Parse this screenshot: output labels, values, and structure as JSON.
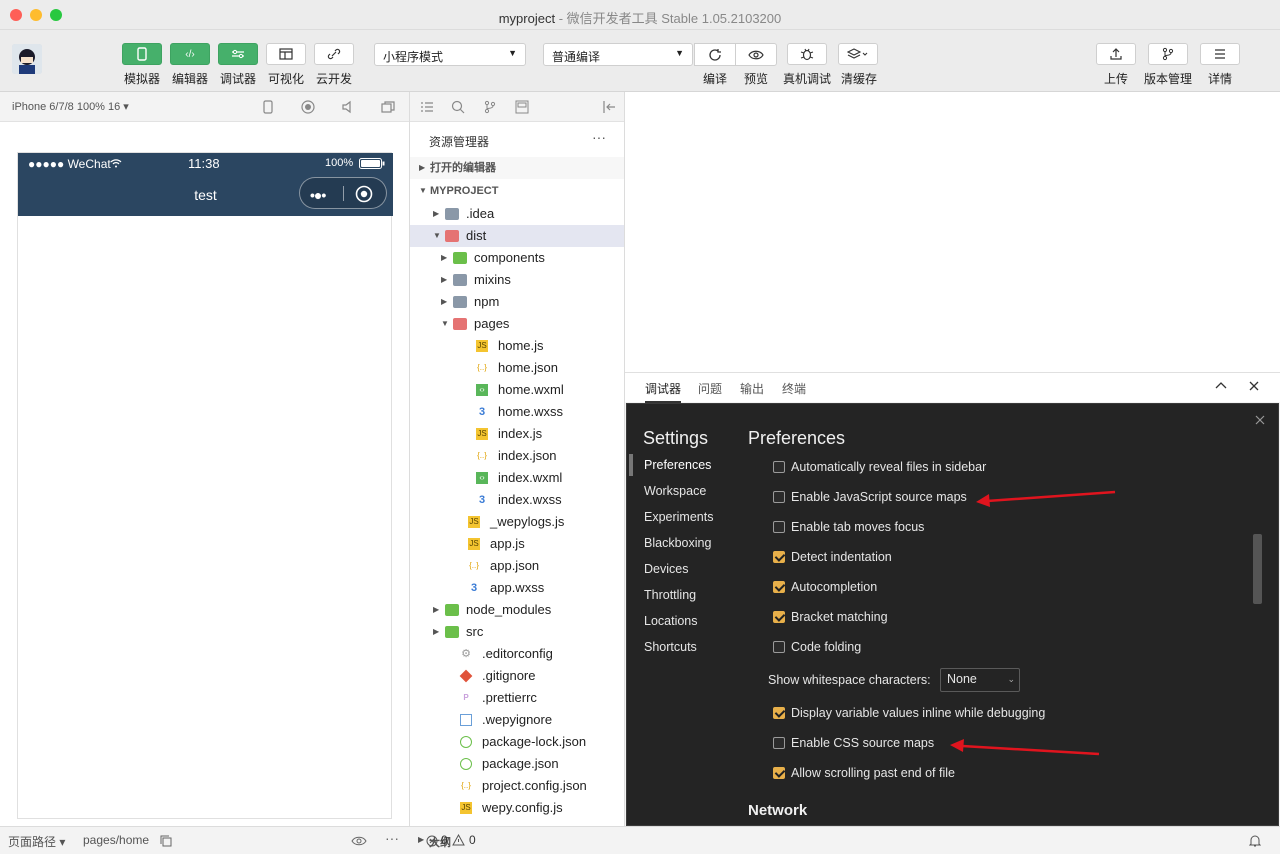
{
  "window": {
    "title": "myproject",
    "subtitle": "-  微信开发者工具 Stable 1.05.2103200"
  },
  "toolbar": {
    "simulator": "模拟器",
    "editor": "编辑器",
    "debugger": "调试器",
    "visual": "可视化",
    "cloud": "云开发",
    "mode_select": "小程序模式",
    "compile_select": "普通编译",
    "compile": "编译",
    "preview": "预览",
    "device_debug": "真机调试",
    "clear_cache": "清缓存",
    "upload": "上传",
    "version": "版本管理",
    "details": "详情"
  },
  "simulator": {
    "device": "iPhone 6/7/8 100% 16 ▾",
    "status_left": "●●●●● WeChat",
    "time": "11:38",
    "battery": "100%",
    "page_title": "test",
    "footer_path_label": "页面路径 ▾",
    "footer_path": "pages/home"
  },
  "explorer": {
    "title": "资源管理器",
    "open_editors": "打开的编辑器",
    "project": "MYPROJECT",
    "outline": "大纲",
    "tree": [
      {
        "name": ".idea",
        "depth": 0,
        "type": "folder",
        "open": false
      },
      {
        "name": "dist",
        "depth": 0,
        "type": "folder-red",
        "open": true,
        "selected": true
      },
      {
        "name": "components",
        "depth": 1,
        "type": "folder-green",
        "open": false
      },
      {
        "name": "mixins",
        "depth": 1,
        "type": "folder",
        "open": false
      },
      {
        "name": "npm",
        "depth": 1,
        "type": "folder",
        "open": false
      },
      {
        "name": "pages",
        "depth": 1,
        "type": "folder-red",
        "open": true
      },
      {
        "name": "home.js",
        "depth": 2,
        "type": "js"
      },
      {
        "name": "home.json",
        "depth": 2,
        "type": "json"
      },
      {
        "name": "home.wxml",
        "depth": 2,
        "type": "wxml"
      },
      {
        "name": "home.wxss",
        "depth": 2,
        "type": "wxss"
      },
      {
        "name": "index.js",
        "depth": 2,
        "type": "js"
      },
      {
        "name": "index.json",
        "depth": 2,
        "type": "json"
      },
      {
        "name": "index.wxml",
        "depth": 2,
        "type": "wxml"
      },
      {
        "name": "index.wxss",
        "depth": 2,
        "type": "wxss"
      },
      {
        "name": "_wepylogs.js",
        "depth": 1,
        "type": "js"
      },
      {
        "name": "app.js",
        "depth": 1,
        "type": "js"
      },
      {
        "name": "app.json",
        "depth": 1,
        "type": "json"
      },
      {
        "name": "app.wxss",
        "depth": 1,
        "type": "wxss"
      },
      {
        "name": "node_modules",
        "depth": 0,
        "type": "folder-green",
        "open": false
      },
      {
        "name": "src",
        "depth": 0,
        "type": "folder-green",
        "open": false
      },
      {
        "name": ".editorconfig",
        "depth": 0,
        "type": "editorconfig"
      },
      {
        "name": ".gitignore",
        "depth": 0,
        "type": "git"
      },
      {
        "name": ".prettierrc",
        "depth": 0,
        "type": "prettier"
      },
      {
        "name": ".wepyignore",
        "depth": 0,
        "type": "file"
      },
      {
        "name": "package-lock.json",
        "depth": 0,
        "type": "npm"
      },
      {
        "name": "package.json",
        "depth": 0,
        "type": "npm"
      },
      {
        "name": "project.config.json",
        "depth": 0,
        "type": "json"
      },
      {
        "name": "wepy.config.js",
        "depth": 0,
        "type": "js"
      }
    ]
  },
  "debugger": {
    "tabs": [
      "调试器",
      "问题",
      "输出",
      "终端"
    ],
    "settings_title": "Settings",
    "preferences_title": "Preferences",
    "sidebar": [
      "Preferences",
      "Workspace",
      "Experiments",
      "Blackboxing",
      "Devices",
      "Throttling",
      "Locations",
      "Shortcuts"
    ],
    "prefs": [
      {
        "label": "Automatically reveal files in sidebar",
        "checked": false
      },
      {
        "label": "Enable JavaScript source maps",
        "checked": false
      },
      {
        "label": "Enable tab moves focus",
        "checked": false
      },
      {
        "label": "Detect indentation",
        "checked": true
      },
      {
        "label": "Autocompletion",
        "checked": true
      },
      {
        "label": "Bracket matching",
        "checked": true
      },
      {
        "label": "Code folding",
        "checked": false
      }
    ],
    "whitespace_label": "Show whitespace characters:",
    "whitespace_value": "None",
    "prefs2": [
      {
        "label": "Display variable values inline while debugging",
        "checked": true
      },
      {
        "label": "Enable CSS source maps",
        "checked": false
      },
      {
        "label": "Allow scrolling past end of file",
        "checked": true
      }
    ],
    "network_heading": "Network",
    "annotation_color": "#e0141e"
  },
  "status": {
    "errors": "0",
    "warnings": "0"
  }
}
